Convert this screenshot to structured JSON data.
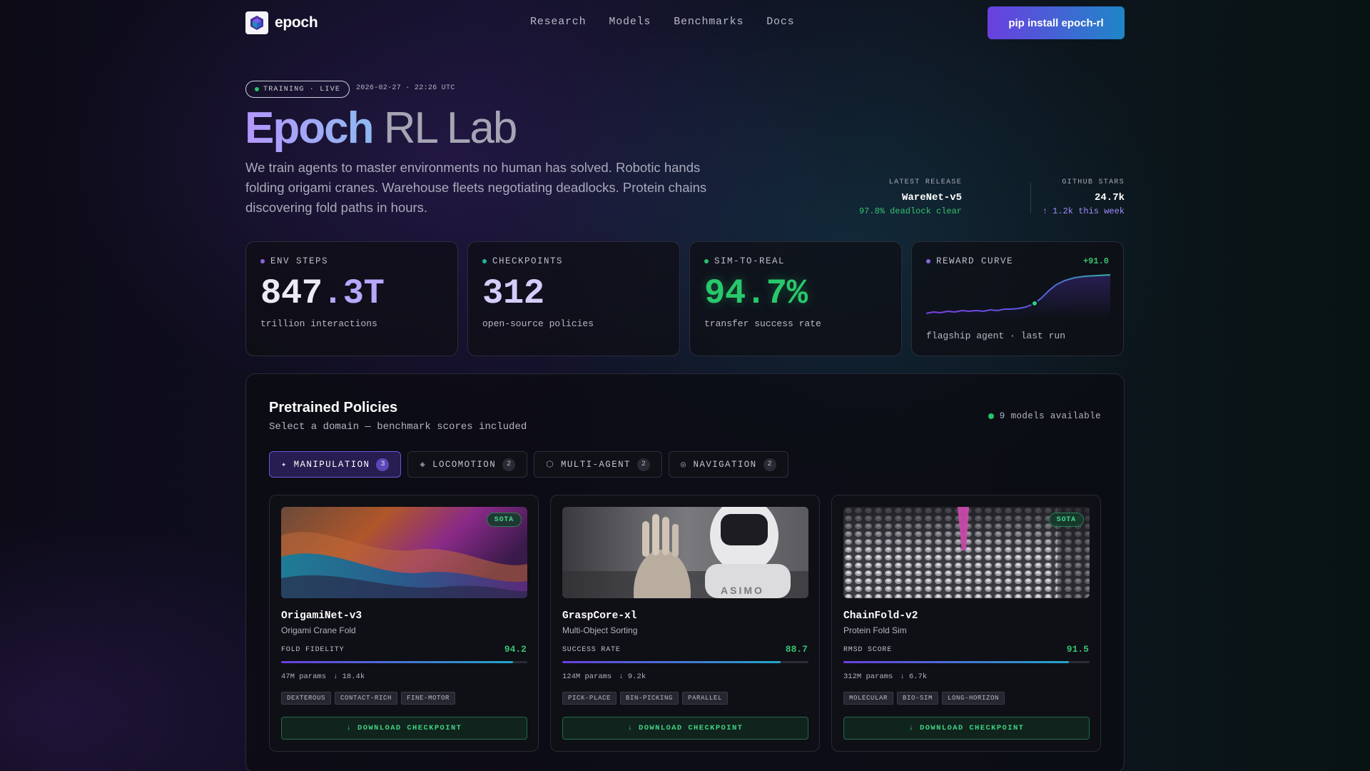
{
  "nav": {
    "brand": "epoch",
    "links": [
      "Research",
      "Models",
      "Benchmarks",
      "Docs"
    ],
    "cta": "pip install epoch-rl"
  },
  "hero": {
    "status_badge": "TRAINING · LIVE",
    "timestamp": "2026-02-27 · 22:26 UTC",
    "title_emphasis": "Epoch",
    "title_rest": "RL Lab",
    "description": "We train agents to master environments no human has solved. Robotic hands folding origami cranes. Warehouse fleets negotiating deadlocks. Protein chains discovering fold paths in hours."
  },
  "kpis": {
    "release": {
      "label": "LATEST RELEASE",
      "value": "WareNet-v5",
      "sub": "97.8% deadlock clear"
    },
    "stars": {
      "label": "GITHUB STARS",
      "value": "24.7k",
      "sub": "↑ 1.2k this week"
    }
  },
  "stats": {
    "env_steps": {
      "label": "ENV STEPS",
      "value_main": "847",
      "value_accent": ".3T",
      "caption": "trillion interactions"
    },
    "checkpoints": {
      "label": "CHECKPOINTS",
      "value": "312",
      "caption": "open-source policies"
    },
    "sim_to_real": {
      "label": "SIM-TO-REAL",
      "value": "94.7%",
      "caption": "transfer success rate"
    },
    "reward_curve": {
      "label": "REWARD CURVE",
      "delta": "+91.0",
      "caption": "flagship agent · last run"
    }
  },
  "panel": {
    "title": "Pretrained Policies",
    "subtitle": "Select a domain — benchmark scores included",
    "available": "9 models available",
    "tabs": [
      {
        "icon": "✦",
        "label": "MANIPULATION",
        "count": "3",
        "active": true
      },
      {
        "icon": "◈",
        "label": "LOCOMOTION",
        "count": "2",
        "active": false
      },
      {
        "icon": "⬡",
        "label": "MULTI-AGENT",
        "count": "2",
        "active": false
      },
      {
        "icon": "◎",
        "label": "NAVIGATION",
        "count": "2",
        "active": false
      }
    ],
    "cards": [
      {
        "badge": "SOTA",
        "name": "OrigamiNet-v3",
        "task": "Origami Crane Fold",
        "metric_label": "FOLD FIDELITY",
        "metric_value": "94.2",
        "params": "47M params",
        "downloads": "↓ 18.4k",
        "tags": [
          "DEXTEROUS",
          "CONTACT-RICH",
          "FINE-MOTOR"
        ],
        "download": "↓ DOWNLOAD CHECKPOINT"
      },
      {
        "badge": "",
        "name": "GraspCore-xl",
        "task": "Multi-Object Sorting",
        "metric_label": "SUCCESS RATE",
        "metric_value": "88.7",
        "params": "124M params",
        "downloads": "↓ 9.2k",
        "tags": [
          "PICK-PLACE",
          "BIN-PICKING",
          "PARALLEL"
        ],
        "download": "↓ DOWNLOAD CHECKPOINT"
      },
      {
        "badge": "SOTA",
        "name": "ChainFold-v2",
        "task": "Protein Fold Sim",
        "metric_label": "RMSD SCORE",
        "metric_value": "91.5",
        "params": "312M params",
        "downloads": "↓ 6.7k",
        "tags": [
          "MOLECULAR",
          "BIO-SIM",
          "LONG-HORIZON"
        ],
        "download": "↓ DOWNLOAD CHECKPOINT"
      }
    ]
  },
  "colors": {
    "accent": "#6a3fe0",
    "teal": "#1f86c8",
    "success": "#36c26f"
  }
}
